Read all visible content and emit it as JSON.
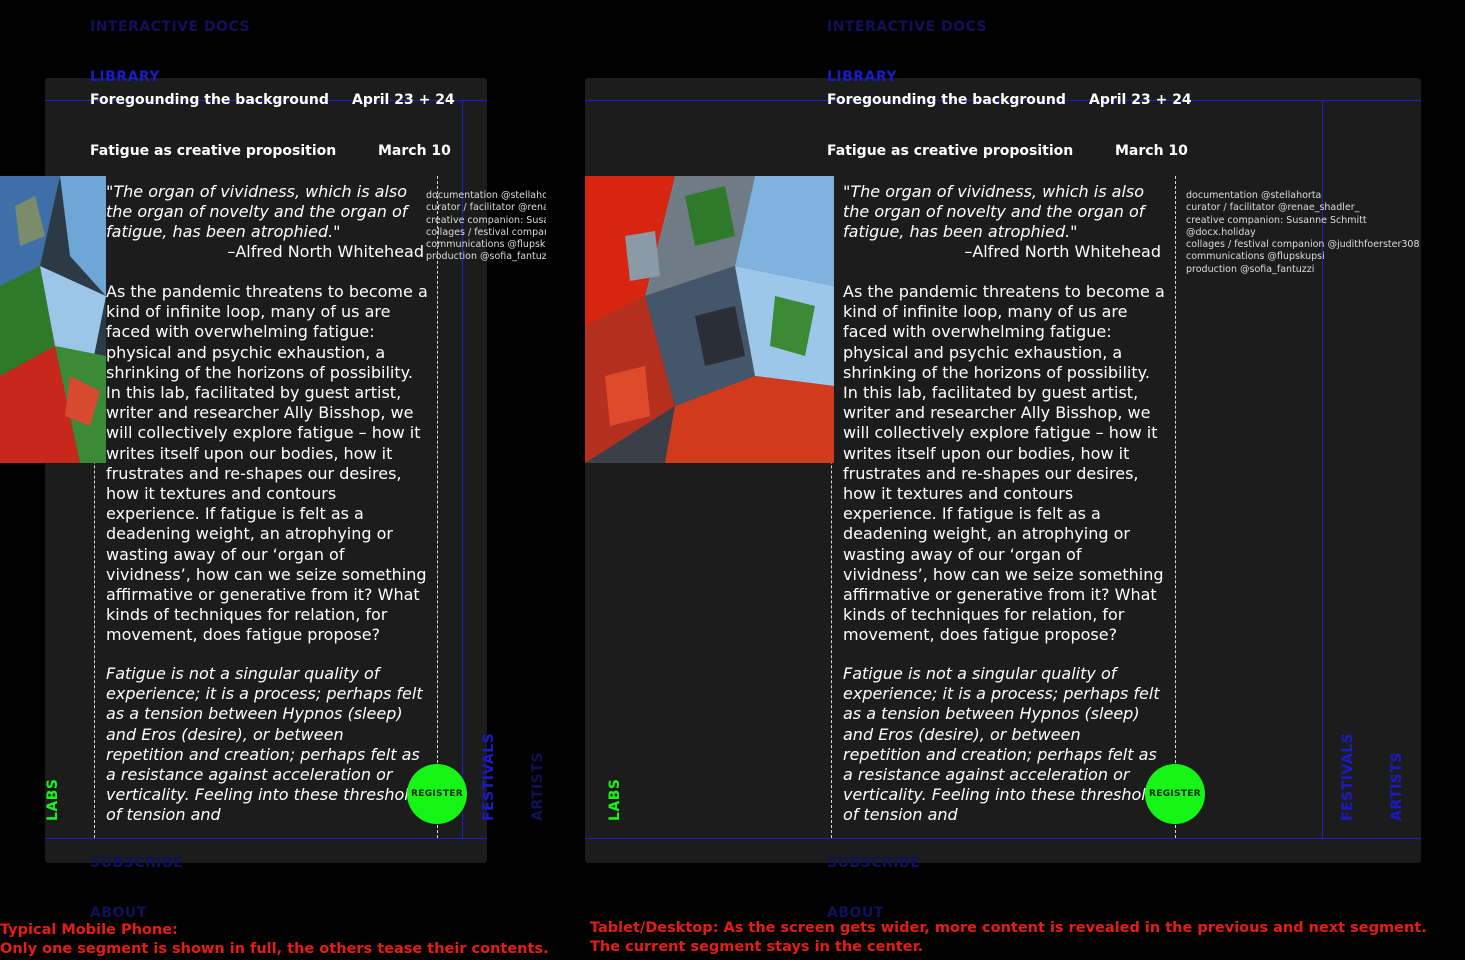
{
  "nav": {
    "interactive_docs": "INTERACTIVE DOCS",
    "library": "LIBRARY",
    "subscribe": "SUBSCRIBE",
    "about": "ABOUT",
    "labs": "LABS",
    "festivals": "FESTIVALS",
    "artists": "ARTISTS"
  },
  "events": [
    {
      "title": "Foregounding the background",
      "date": "April 23 + 24"
    },
    {
      "title": "Fatigue as creative proposition",
      "date": "March 10"
    }
  ],
  "quote": {
    "text": "\"The organ of vividness, which is also the organ of novelty and the organ of fatigue, has been atrophied.\"",
    "attribution": "–Alfred North Whitehead"
  },
  "body": "As the pandemic threatens to become a\nkind of infinite loop, many of us are\nfaced with overwhelming fatigue:\nphysical and psychic exhaustion, a\nshrinking of the horizons of possibility.\nIn this lab, facilitated by guest artist,\nwriter and researcher Ally Bisshop, we\nwill collectively explore fatigue – how it\nwrites itself upon our bodies, how it\nfrustrates and re-shapes our desires,\nhow it textures and contours\nexperience. If fatigue is felt as a\ndeadening weight, an atrophying or\nwasting away of our ‘organ of\nvividness’, how can we seize something\naffirmative or generative from it? What\nkinds of techniques for relation, for\nmovement, does fatigue propose?",
  "italic": "Fatigue is not a singular quality of\nexperience; it is a process; perhaps felt\nas a tension between Hypnos (sleep)\nand Eros (desire), or between\nrepetition and creation; perhaps felt as\na resistance against acceleration or\nverticality. Feeling into these threshol\nof tension and",
  "credits": "documentation @stellahorta\ncurator / facilitator @renae_shadler_\ncreative companion: Susanne Schmitt @docx.holiday\ncollages / festival companion @judithfoerster308\ncommunications @flupskupsi\nproduction @sofia_fantuzzi",
  "register_label": "REGISTER",
  "captions": {
    "mobile": "Typical Mobile Phone:\nOnly one segment is shown in full, the others tease their contents.",
    "desktop": "Tablet/Desktop: As the screen gets wider, more content is revealed in the previous and next segment.\nThe current segment stays in the center."
  },
  "colors": {
    "accent_green": "#16f516",
    "line_blue": "#1f1fd0",
    "caption_red": "#e61e12",
    "panel_bg": "#1c1c1c"
  }
}
